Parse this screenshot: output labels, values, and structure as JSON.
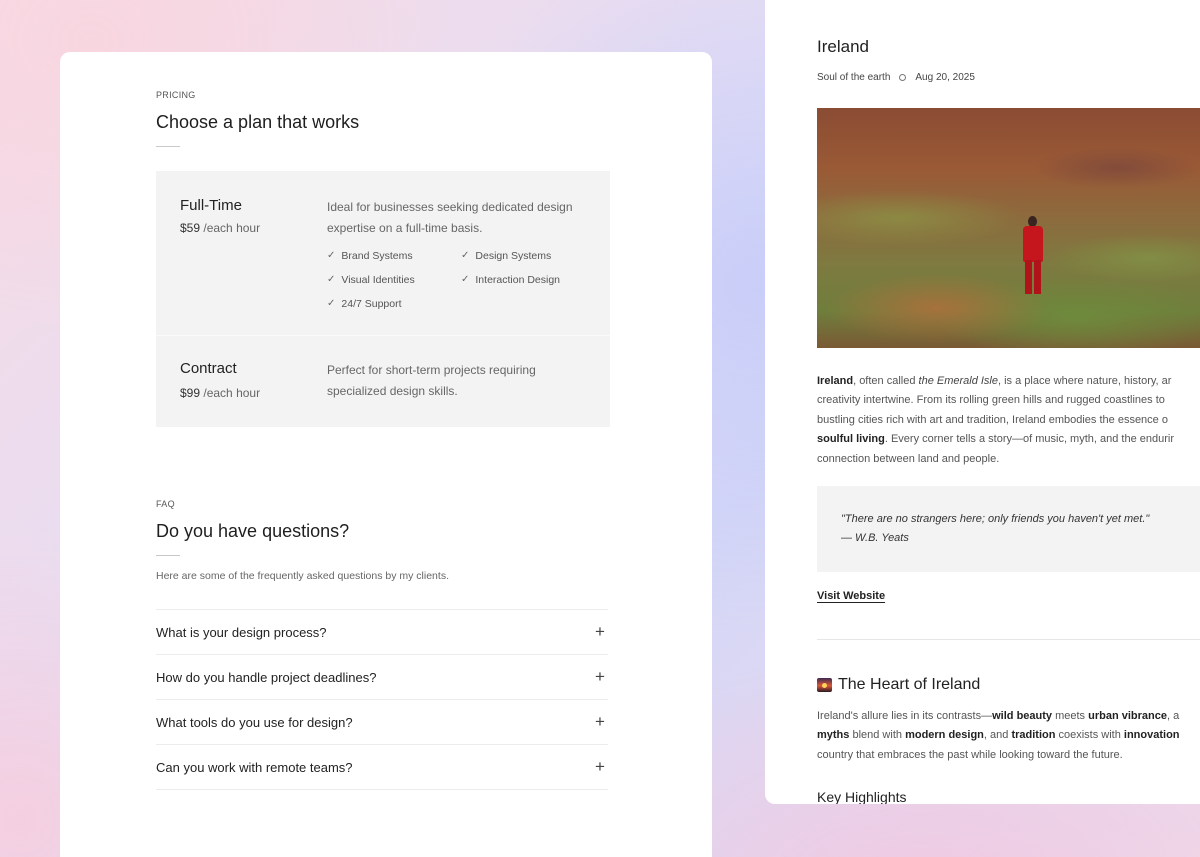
{
  "pricing": {
    "eyebrow": "PRICING",
    "title": "Choose a plan that works",
    "plans": [
      {
        "name": "Full-Time",
        "price": "$59",
        "unit": "/each hour",
        "description": "Ideal for businesses seeking dedicated design expertise on a full-time basis.",
        "features": [
          "Brand Systems",
          "Design Systems",
          "Visual Identities",
          "Interaction Design",
          "24/7 Support"
        ]
      },
      {
        "name": "Contract",
        "price": "$99",
        "unit": "/each hour",
        "description": "Perfect for short-term projects requiring specialized design skills."
      }
    ]
  },
  "faq": {
    "eyebrow": "FAQ",
    "title": "Do you have questions?",
    "intro": "Here are some of the frequently asked questions by my clients.",
    "items": [
      "What is your design process?",
      "How do you handle project deadlines?",
      "What tools do you use for design?",
      "Can you work with remote teams?"
    ],
    "expand_icon": "+"
  },
  "article": {
    "title": "Ireland",
    "subtitle": "Soul of the earth",
    "date": "Aug 20, 2025",
    "paragraph1": {
      "l1a": "Ireland",
      "l1b": ", often called ",
      "l1c": "the Emerald Isle",
      "l1d": ", is a place where nature, history, ar",
      "l2": "creativity intertwine. From its rolling green hills and rugged coastlines to",
      "l3": "bustling cities rich with art and tradition, Ireland embodies the essence o",
      "l4a": "soulful living",
      "l4b": ". Every corner tells a story—of music, myth, and the endurir",
      "l5": "connection between land and people."
    },
    "quote": "\"There are no strangers here; only friends you haven't yet met.\"",
    "quote_author": "— W.B. Yeats",
    "link": "Visit Website",
    "section_title": "The Heart of Ireland",
    "paragraph2": {
      "l1a": "Ireland's allure lies in its contrasts—",
      "l1b": "wild beauty",
      "l1c": " meets ",
      "l1d": "urban vibrance",
      "l1e": ", a",
      "l2a": "myths",
      "l2b": " blend with ",
      "l2c": "modern design",
      "l2d": ", and ",
      "l2e": "tradition",
      "l2f": " coexists with ",
      "l2g": "innovation",
      "l3": "country that embraces the past while looking toward the future."
    },
    "subheading": "Key Highlights"
  }
}
